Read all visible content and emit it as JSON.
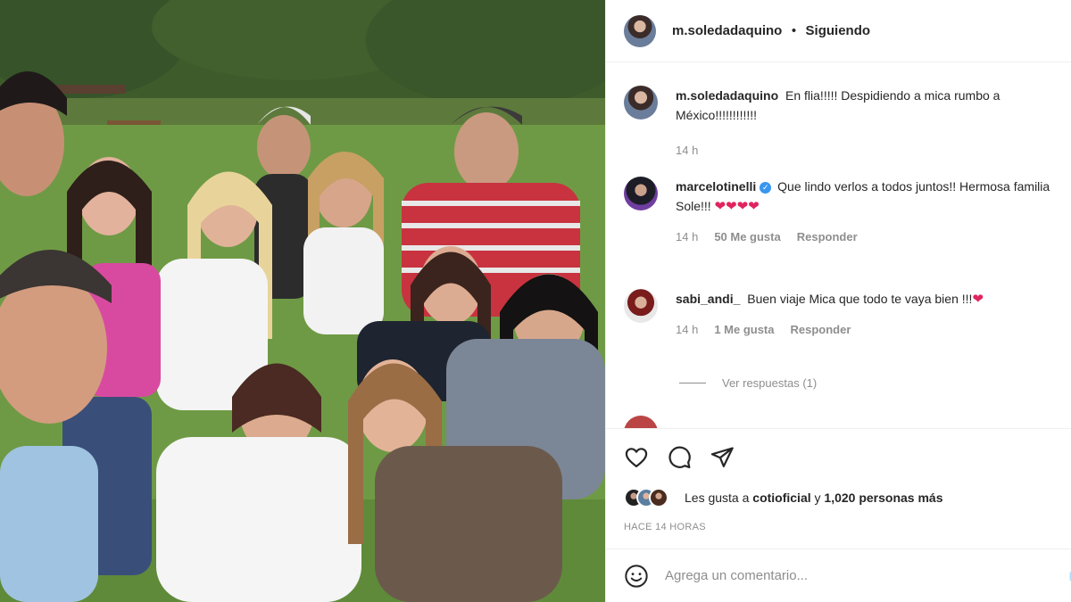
{
  "post": {
    "username": "m.soledadaquino",
    "separator": "•",
    "follow_status": "Siguiendo"
  },
  "comments": [
    {
      "username": "m.soledadaquino",
      "text": "En flia!!!!! Despidiendo a mica rumbo a México!!!!!!!!!!!!",
      "time": "14 h",
      "likes": "",
      "reply": ""
    },
    {
      "username": "marcelotinelli",
      "verified": true,
      "text": "Que lindo verlos a todos juntos!! Hermosa familia Sole!!! ",
      "hearts": "❤❤❤❤",
      "time": "14 h",
      "likes": "50 Me gusta",
      "reply": "Responder"
    },
    {
      "username": "sabi_andi_",
      "text": "Buen viaje Mica que todo te vaya bien !!!",
      "hearts": "❤",
      "time": "14 h",
      "likes": "1 Me gusta",
      "reply": "Responder"
    }
  ],
  "view_replies": "Ver respuestas (1)",
  "actions": {
    "like_icon": "heart-outline-icon",
    "comment_icon": "comment-bubble-icon",
    "share_icon": "paper-plane-icon"
  },
  "likes": {
    "prefix": "Les gusta a ",
    "user": "cotioficial",
    "middle": " y ",
    "count": "1,020 personas más"
  },
  "timestamp": "HACE 14 HORAS",
  "add_comment": {
    "placeholder": "Agrega un comentario...",
    "publish": "P"
  },
  "colors": {
    "text": "#262626",
    "muted": "#8e8e8e",
    "heart": "#e0245e",
    "verified": "#3897f0",
    "border": "#efefef"
  }
}
